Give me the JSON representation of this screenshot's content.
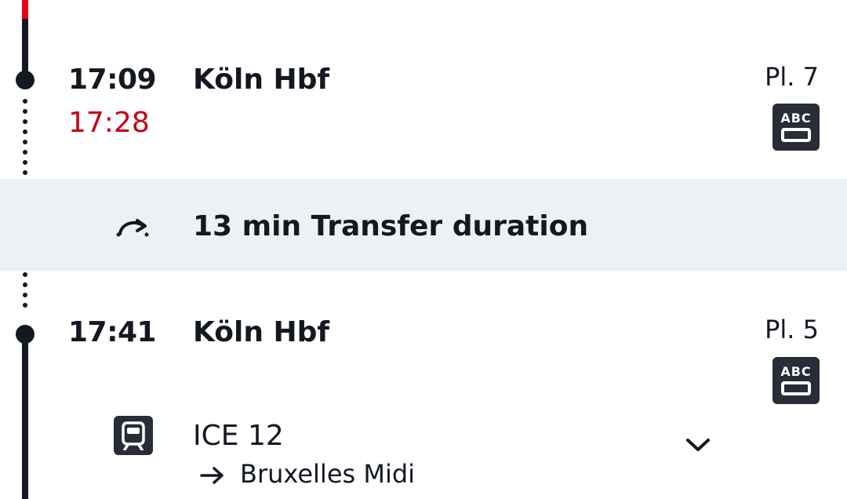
{
  "stop1": {
    "scheduled_time": "17:09",
    "actual_time": "17:28",
    "station": "Köln Hbf",
    "platform": "Pl. 7",
    "wagon_icon_text": "ABC"
  },
  "transfer": {
    "icon": "transfer-arrow-icon",
    "text": "13 min Transfer duration"
  },
  "stop2": {
    "scheduled_time": "17:41",
    "station": "Köln Hbf",
    "platform": "Pl. 5",
    "wagon_icon_text": "ABC"
  },
  "train": {
    "icon": "train-icon",
    "name": "ICE 12",
    "destination": "Bruxelles Midi",
    "expand_icon": "chevron-down-icon"
  },
  "colors": {
    "delay": "#c50014",
    "timeline": "#131821",
    "timeline_accent": "#ec0016",
    "transfer_background": "#eef1f4",
    "icon_background": "#282d37"
  }
}
